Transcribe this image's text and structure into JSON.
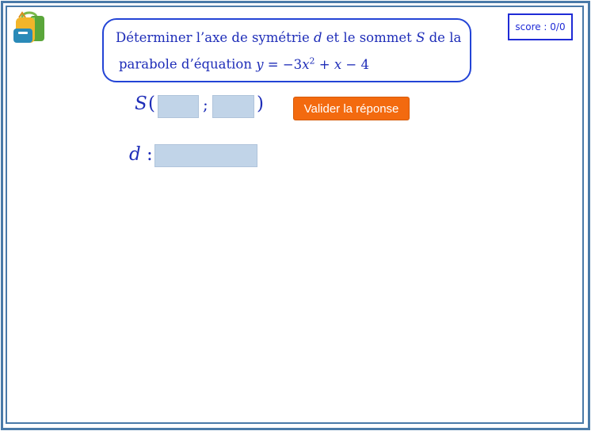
{
  "score": {
    "label": "score : 0/0"
  },
  "question": {
    "line1": "Déterminer l’axe de symétrie d et le sommet S de la",
    "line1_parts": [
      "Déterminer l’axe de symétrie ",
      "d",
      " et le sommet ",
      "S",
      " de la"
    ],
    "line2_prefix": "parabole d’équation ",
    "equation_parts": [
      "y",
      " = −3",
      "x",
      "2",
      " + ",
      "x",
      " − 4"
    ]
  },
  "answer": {
    "s_label": "S",
    "open_paren": "(",
    "separator": ";",
    "close_paren": ")",
    "s_x_value": "",
    "s_y_value": "",
    "d_label": "d",
    "d_colon": ":",
    "d_value": ""
  },
  "validate_button": {
    "label": "Valider la réponse"
  },
  "colors": {
    "frame": "#4a7aa8",
    "text_blue": "#1e2db8",
    "field_fill": "#c1d4e8",
    "button_orange": "#f36a0f"
  },
  "icons": {
    "logo": "backpack-icon"
  }
}
